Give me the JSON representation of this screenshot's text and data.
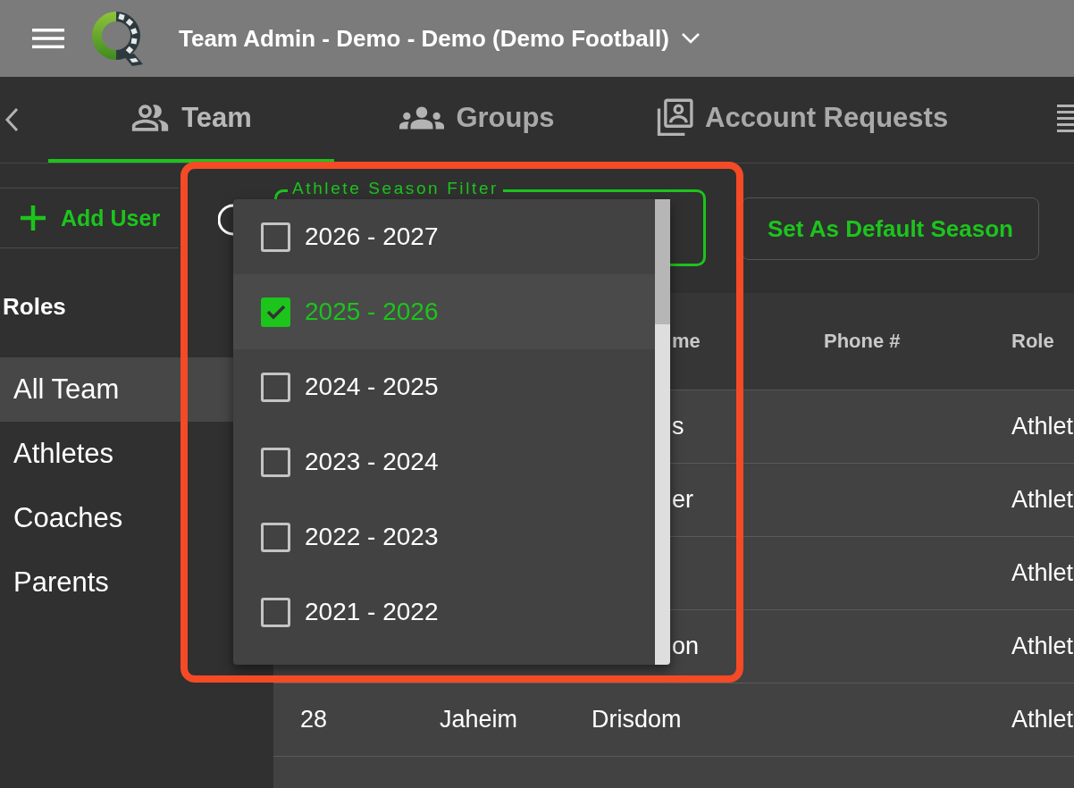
{
  "app_bar": {
    "title": "Team Admin - Demo - Demo (Demo Football)"
  },
  "tabs": [
    {
      "label": "Team",
      "selected": true
    },
    {
      "label": "Groups",
      "selected": false
    },
    {
      "label": "Account Requests",
      "selected": false
    }
  ],
  "toolbar": {
    "add_button": "Add User",
    "season_filter": {
      "label": "Athlete Season Filter"
    },
    "default_button": "Set As Default Season"
  },
  "sidebar": {
    "heading": "Roles",
    "items": [
      {
        "label": "All Team",
        "selected": true
      },
      {
        "label": "Athletes",
        "selected": false
      },
      {
        "label": "Coaches",
        "selected": false
      },
      {
        "label": "Parents",
        "selected": false
      }
    ]
  },
  "table": {
    "header": {
      "column_3": "me",
      "phone": "Phone #",
      "role": "Role"
    },
    "rows": [
      {
        "column_3": "s",
        "role": "Athlet"
      },
      {
        "column_3": "er",
        "role": "Athlet"
      },
      {
        "role": "Athlet"
      },
      {
        "column_3": "on",
        "role": "Athlet"
      },
      {
        "column_1": "28",
        "column_2": "Jaheim",
        "column_3": "Drisdom",
        "role": "Athlet"
      }
    ]
  },
  "season_menu": {
    "options": [
      {
        "label": "2026 - 2027",
        "checked": false,
        "selected": false
      },
      {
        "label": "2025 - 2026",
        "checked": true,
        "selected": true
      },
      {
        "label": "2024 - 2025",
        "checked": false,
        "selected": false
      },
      {
        "label": "2023 - 2024",
        "checked": false,
        "selected": false
      },
      {
        "label": "2022 - 2023",
        "checked": false,
        "selected": false
      },
      {
        "label": "2021 - 2022",
        "checked": false,
        "selected": false
      }
    ]
  }
}
